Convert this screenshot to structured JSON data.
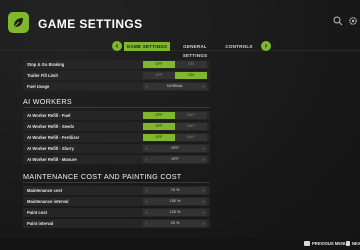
{
  "header": {
    "title": "GAME SETTINGS"
  },
  "tabs": [
    {
      "label": "GAME SETTINGS"
    },
    {
      "label": "GENERAL SETTINGS"
    },
    {
      "label": "CONTROLS"
    }
  ],
  "top_rows": [
    {
      "label": "Stop & Go Braking",
      "off": "OFF",
      "on": "ON",
      "selected": "off"
    },
    {
      "label": "Trailer Fill Limit",
      "off": "OFF",
      "on": "ON",
      "selected": "on"
    },
    {
      "label": "Fuel Usage",
      "value": "NORMAL"
    }
  ],
  "ai_workers": {
    "title": "AI WORKERS",
    "rows": [
      {
        "label": "AI Worker Refill - Fuel",
        "off": "OFF",
        "on": "BUY",
        "selected": "off"
      },
      {
        "label": "AI Worker Refill - Seeds",
        "off": "OFF",
        "on": "BUY",
        "selected": "off"
      },
      {
        "label": "AI Worker Refill - Fertilizer",
        "off": "OFF",
        "on": "BUY",
        "selected": "off"
      },
      {
        "label": "AI Worker Refill - Slurry",
        "value": "OFF"
      },
      {
        "label": "AI Worker Refill - Manure",
        "value": "OFF"
      }
    ]
  },
  "maintenance": {
    "title": "MAINTENANCE COST AND PAINTING COST",
    "rows": [
      {
        "label": "Maintenance cost",
        "value": "75 %"
      },
      {
        "label": "Maintenance interval",
        "value": "150 %"
      },
      {
        "label": "Paint cost",
        "value": "125 %"
      },
      {
        "label": "Paint interval",
        "value": "25 %"
      }
    ]
  },
  "footer": {
    "previous_menu": "PREVIOUS MENU",
    "next_menu": "NEXT M"
  },
  "colors": {
    "accent": "#7fb82c",
    "background": "#1c1c1c",
    "row": "#262626"
  }
}
